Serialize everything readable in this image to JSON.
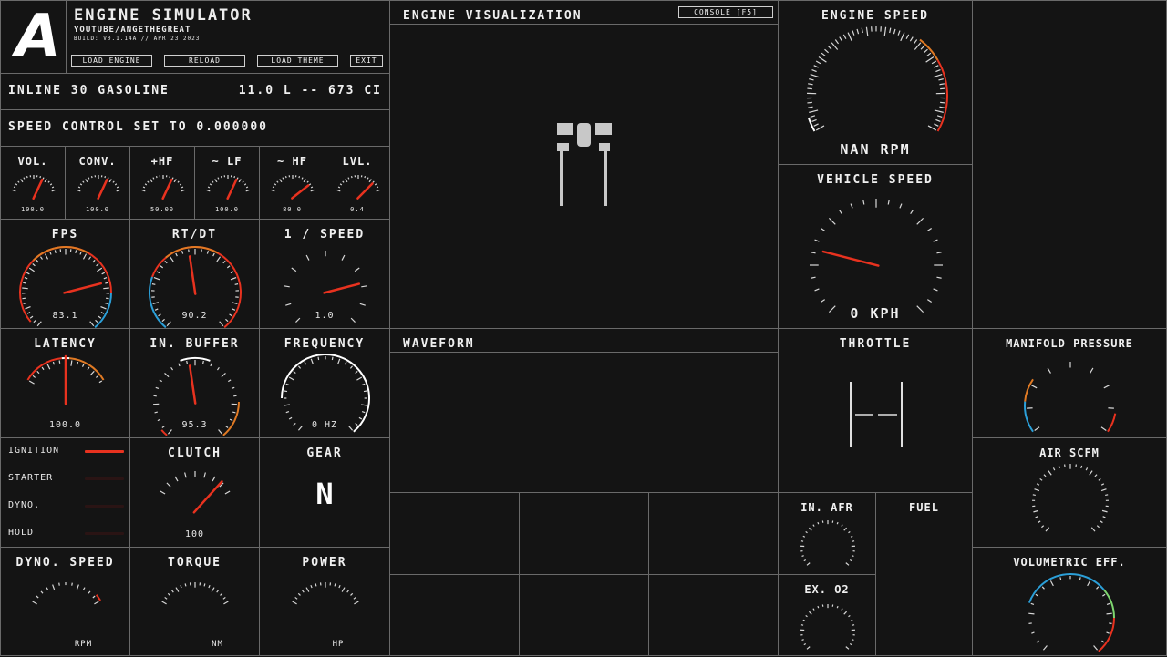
{
  "header": {
    "logo": "A",
    "title": "ENGINE SIMULATOR",
    "subtitle": "YOUTUBE/ANGETHEGREAT",
    "build": "BUILD: V0.1.14A // APR 23 2023",
    "buttons": {
      "load_engine": "LOAD ENGINE",
      "reload": "RELOAD",
      "load_theme": "LOAD THEME",
      "exit": "EXIT"
    }
  },
  "engine_info": {
    "name": "INLINE 30 GASOLINE",
    "displacement": "11.0 L -- 673 CI"
  },
  "speed_control": "SPEED CONTROL SET TO 0.000000",
  "mix_gauges": [
    {
      "label": "VOL.",
      "value": "100.0",
      "level": 0.68
    },
    {
      "label": "CONV.",
      "value": "100.0",
      "level": 0.68
    },
    {
      "label": "+HF",
      "value": "50.00",
      "level": 0.68
    },
    {
      "label": "~ LF",
      "value": "100.0",
      "level": 0.68
    },
    {
      "label": "~ HF",
      "value": "80.0",
      "level": 0.87
    },
    {
      "label": "LVL.",
      "value": "0.4",
      "level": 0.82
    }
  ],
  "perf_gauges": [
    {
      "label": "FPS",
      "value": "83.1",
      "level": 0.77
    },
    {
      "label": "RT/DT",
      "value": "90.2",
      "level": 0.47
    },
    {
      "label": "1 / SPEED",
      "value": "1.0",
      "level": 0.78
    }
  ],
  "audio_gauges": {
    "latency": {
      "label": "LATENCY",
      "value": "100.0",
      "level": 0.5
    },
    "input_buffer": {
      "label": "IN. BUFFER",
      "value": "95.3",
      "level": 0.47
    },
    "frequency": {
      "label": "FREQUENCY",
      "value": "0 HZ"
    }
  },
  "visualization": {
    "title": "ENGINE VISUALIZATION",
    "console_button": "CONSOLE [F5]"
  },
  "engine_speed": {
    "title": "ENGINE SPEED",
    "value": "NAN RPM"
  },
  "vehicle_speed": {
    "title": "VEHICLE SPEED",
    "value": "0 KPH",
    "level": 0.22
  },
  "waveform": {
    "title": "WAVEFORM"
  },
  "throttle": {
    "title": "THROTTLE"
  },
  "manifold_pressure": {
    "title": "MANIFOLD PRESSURE"
  },
  "air_scfm": {
    "title": "AIR SCFM"
  },
  "in_afr": {
    "title": "IN. AFR"
  },
  "ex_o2": {
    "title": "EX. O2"
  },
  "fuel": {
    "title": "FUEL"
  },
  "volumetric_eff": {
    "title": "VOLUMETRIC EFF."
  },
  "switches": {
    "ignition": {
      "label": "IGNITION",
      "on": true
    },
    "starter": {
      "label": "STARTER",
      "on": false
    },
    "dyno": {
      "label": "DYNO.",
      "on": false
    },
    "hold": {
      "label": "HOLD",
      "on": false
    }
  },
  "clutch": {
    "title": "CLUTCH",
    "value": "100",
    "level": 0.85
  },
  "gear": {
    "title": "GEAR",
    "value": "N"
  },
  "dyno_speed": {
    "title": "DYNO. SPEED",
    "unit": "RPM"
  },
  "torque": {
    "title": "TORQUE",
    "unit": "NM"
  },
  "power": {
    "title": "POWER",
    "unit": "HP"
  },
  "colors": {
    "needle": "#e8321f",
    "warn": "#e07a24",
    "cool": "#2b9fd8",
    "good": "#7ed66f",
    "frame": "#6a6a6a"
  }
}
